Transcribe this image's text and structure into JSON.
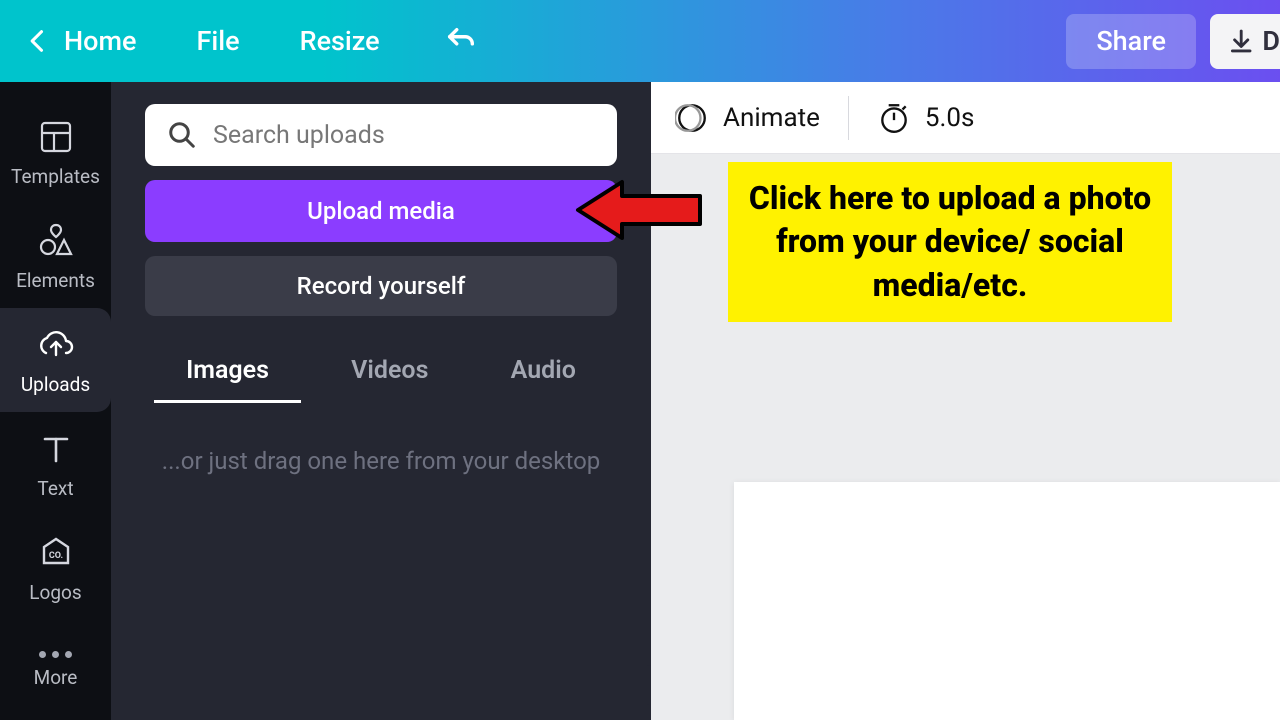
{
  "topbar": {
    "home": "Home",
    "file": "File",
    "resize": "Resize",
    "share": "Share",
    "download_fragment": "D"
  },
  "sidebar": {
    "templates": "Templates",
    "elements": "Elements",
    "uploads": "Uploads",
    "text": "Text",
    "logos": "Logos",
    "more": "More"
  },
  "panel": {
    "search_placeholder": "Search uploads",
    "upload_media": "Upload media",
    "record_yourself": "Record yourself",
    "tabs": {
      "images": "Images",
      "videos": "Videos",
      "audio": "Audio"
    },
    "dropzone": "...or just drag one here from your desktop"
  },
  "toolbar": {
    "animate": "Animate",
    "duration": "5.0s"
  },
  "callout": {
    "text": "Click here to upload a photo from your device/ social media/etc."
  },
  "panel_collapse_glyph": "‹"
}
